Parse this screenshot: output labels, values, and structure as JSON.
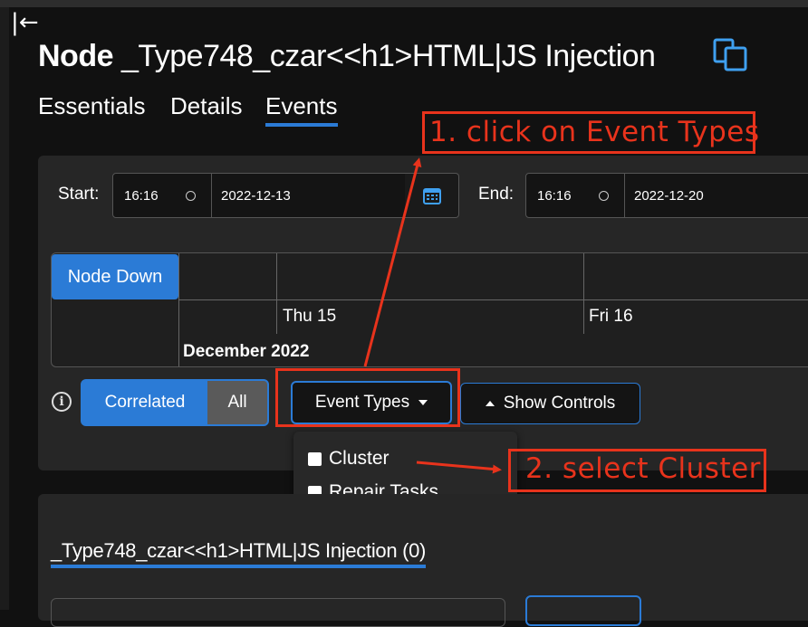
{
  "page": {
    "collapse_glyph": "|←",
    "title_bold": "Node",
    "title_rest": " _Type748_czar<<h1>HTML|JS Injection",
    "copy_icon": "copy-icon"
  },
  "tabs": [
    {
      "label": "Essentials",
      "active": false
    },
    {
      "label": "Details",
      "active": false
    },
    {
      "label": "Events",
      "active": true
    }
  ],
  "filters": {
    "start_label": "Start:",
    "start_time": "16:16",
    "start_date": "2022-12-13",
    "end_label": "End:",
    "end_time": "16:16",
    "end_date": "2022-12-20"
  },
  "timeline": {
    "row_label": "Node Down",
    "ticks": [
      "Thu 15",
      "Fri 16"
    ],
    "month": "December 2022"
  },
  "controls": {
    "info_glyph": "i",
    "correlated_label": "Correlated",
    "all_label": "All",
    "event_types_label": "Event Types",
    "show_controls_label": "Show Controls"
  },
  "dropdown": {
    "options": [
      {
        "label": "Cluster",
        "checked": false
      },
      {
        "label": "Repair Tasks",
        "checked": false
      }
    ]
  },
  "annotations": {
    "step1": "1. click on Event Types",
    "step2": "2. select Cluster",
    "color": "#e8331c"
  },
  "section2": {
    "title": "_Type748_czar<<h1>HTML|JS Injection (0)"
  },
  "colors": {
    "accent": "#2b7bd6",
    "background": "#111111",
    "panel": "#262626"
  }
}
